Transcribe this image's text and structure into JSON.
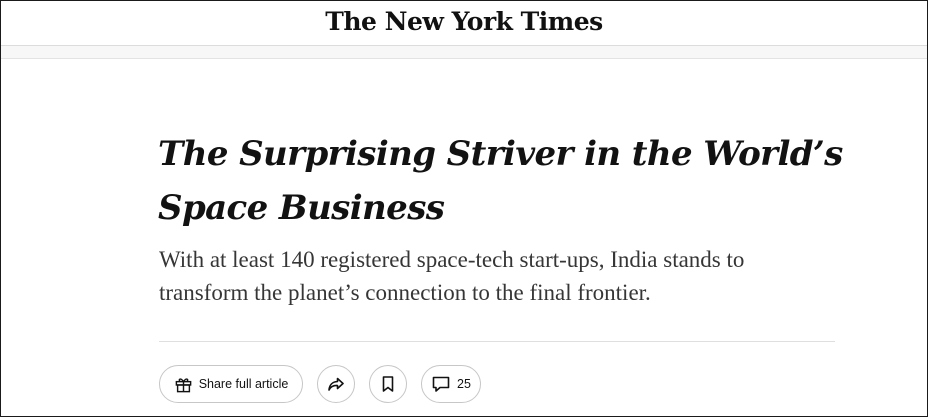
{
  "masthead": {
    "logo_text": "The New York Times"
  },
  "article": {
    "headline_line1": "The Surprising Striver in the World’s",
    "headline_line2": "Space Business",
    "summary_line1": "With at least 140 registered space-tech start-ups, India stands to",
    "summary_line2": "transform the planet’s connection to the final frontier."
  },
  "toolbar": {
    "share_full_label": "Share full article",
    "comment_count": "25",
    "icons": {
      "gift": "gift-icon",
      "share": "share-arrow-icon",
      "save": "bookmark-icon",
      "comments": "comment-icon"
    }
  },
  "colors": {
    "text": "#121212",
    "summary_text": "#363636",
    "border": "#c7c7c7",
    "divider": "#dfdfdf"
  }
}
